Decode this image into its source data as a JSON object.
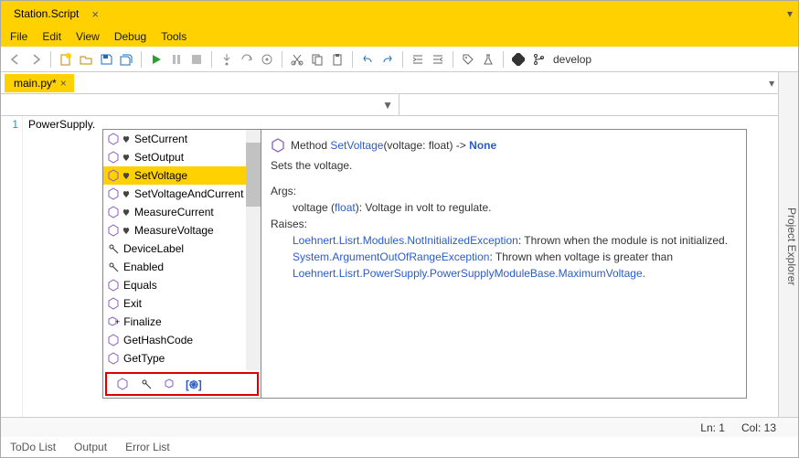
{
  "window": {
    "title": "Station.Script"
  },
  "menu": {
    "file": "File",
    "edit": "Edit",
    "view": "View",
    "debug": "Debug",
    "tools": "Tools"
  },
  "toolbar": {
    "branch": "develop"
  },
  "document": {
    "tab": "main.py*",
    "line1": "PowerSupply.",
    "ln_no": "1"
  },
  "side_panel": {
    "label": "Project Explorer"
  },
  "status": {
    "ln": "Ln:  1",
    "col": "Col:  13"
  },
  "bottom": {
    "todo": "ToDo List",
    "output": "Output",
    "errors": "Error List"
  },
  "ac": {
    "items": [
      {
        "label": "SetCurrent",
        "kind": "method-heart"
      },
      {
        "label": "SetOutput",
        "kind": "method-heart"
      },
      {
        "label": "SetVoltage",
        "kind": "method-heart",
        "selected": true
      },
      {
        "label": "SetVoltageAndCurrent",
        "kind": "method-heart"
      },
      {
        "label": "MeasureCurrent",
        "kind": "method-heart"
      },
      {
        "label": "MeasureVoltage",
        "kind": "method-heart"
      },
      {
        "label": "DeviceLabel",
        "kind": "prop"
      },
      {
        "label": "Enabled",
        "kind": "prop"
      },
      {
        "label": "Equals",
        "kind": "method"
      },
      {
        "label": "Exit",
        "kind": "method"
      },
      {
        "label": "Finalize",
        "kind": "method-small"
      },
      {
        "label": "GetHashCode",
        "kind": "method"
      },
      {
        "label": "GetType",
        "kind": "method"
      }
    ]
  },
  "doc": {
    "kind": "Method",
    "name": "SetVoltage",
    "sig_open": "(voltage: float) ->",
    "ret": "None",
    "summary": "Sets the voltage.",
    "args_h": "Args:",
    "arg_line_a": "voltage (",
    "arg_type": "float",
    "arg_line_b": "): Voltage in volt to regulate.",
    "raises_h": "Raises:",
    "r1a": "Loehnert.Lisrt.Modules.NotInitializedException",
    "r1b": ": Thrown when the module is not initialized.",
    "r2a": "System.ArgumentOutOfRangeException",
    "r2b": ": Thrown when voltage is greater than",
    "r3a": "Loehnert.Lisrt.PowerSupply.PowerSupplyModuleBase.MaximumVoltage",
    "r3b": "."
  }
}
